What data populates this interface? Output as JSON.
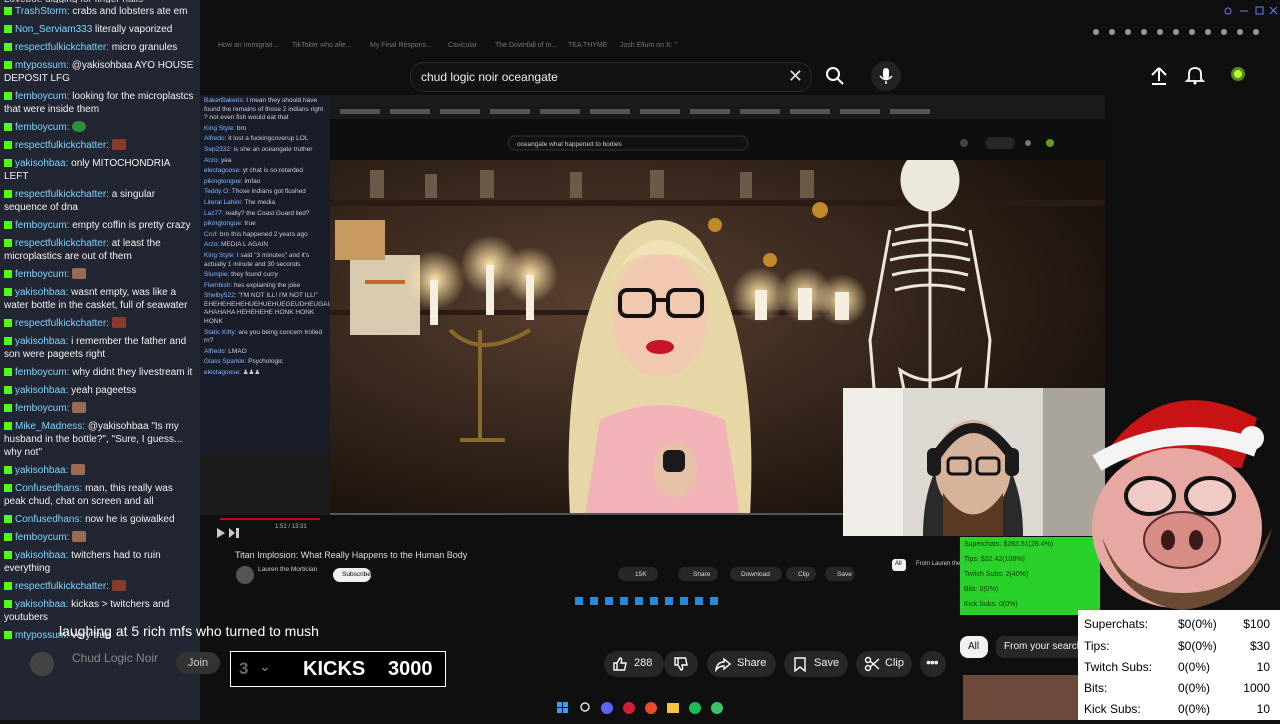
{
  "chat": [
    {
      "user": "TrashStorm:",
      "text": "crabs and lobsters ate em"
    },
    {
      "user": "Non_Serviam333",
      "text": "literally vaporized"
    },
    {
      "user": "respectfulkickchatter:",
      "text": "micro granules"
    },
    {
      "user": "mtypossum:",
      "text": "@yakisohbaa AYO HOUSE DEPOSIT LFG"
    },
    {
      "user": "femboycum:",
      "text": "looking for the microplastcs that were inside them"
    },
    {
      "user": "femboycum:",
      "text": "",
      "emote": "g"
    },
    {
      "user": "respectfulkickchatter:",
      "text": "",
      "emote": "r"
    },
    {
      "user": "yakisohbaa:",
      "text": "only MITOCHONDRIA LEFT"
    },
    {
      "user": "respectfulkickchatter:",
      "text": "a singular sequence of dna"
    },
    {
      "user": "femboycum:",
      "text": "empty coffin is pretty crazy"
    },
    {
      "user": "respectfulkickchatter:",
      "text": "at least the microplastics are out of them"
    },
    {
      "user": "femboycum:",
      "text": "",
      "emote": "e"
    },
    {
      "user": "yakisohbaa:",
      "text": "wasnt empty, was like a water bottle in the casket, full of seawater"
    },
    {
      "user": "respectfulkickchatter:",
      "text": "",
      "emote": "r"
    },
    {
      "user": "yakisohbaa:",
      "text": "i remember the father and son were pageets right"
    },
    {
      "user": "femboycum:",
      "text": "why didnt they livestream it"
    },
    {
      "user": "yakisohbaa:",
      "text": "yeah pageetss"
    },
    {
      "user": "femboycum:",
      "text": "",
      "emote": "e"
    },
    {
      "user": "Mike_Madness:",
      "text": "@yakisohbaa \"Is my husband in the bottle?\", \"Sure, I guess... why not\""
    },
    {
      "user": "yakisohbaa:",
      "text": "",
      "emote": "e"
    },
    {
      "user": "Confusedhans:",
      "text": "man, this really was peak chud, chat on screen and all"
    },
    {
      "user": "Confusedhans:",
      "text": "now he is goiwalked"
    },
    {
      "user": "femboycum:",
      "text": "",
      "emote": "e"
    },
    {
      "user": "yakisohbaa:",
      "text": "twitchers had to ruin everything"
    },
    {
      "user": "respectfulkickchatter:",
      "text": "",
      "emote": "r"
    },
    {
      "user": "yakisohbaa:",
      "text": "kickas > twitchers and youtubers"
    },
    {
      "user": "mtypossum:",
      "text": "very true"
    }
  ],
  "header": {
    "search_query": "chud logic noir oceangate",
    "tabs_ghost": [
      "How an Immigrati...",
      "TikToker who alle...",
      "My Final Respons...",
      "Cavicular",
      "The Downfall of In...",
      "TEA THYME",
      "Josh Ellum on X: \""
    ]
  },
  "inner": {
    "search": "oceangate what happened to bodies",
    "title": "Titan Implosion: What Really Happens to the Human Body",
    "channel": "Lauren the Mortician",
    "subscribe": "Subscribe",
    "time": "1:51 / 13:31",
    "likes": "15K",
    "actions": [
      "Share",
      "Download",
      "Clip",
      "Save"
    ],
    "chat": [
      {
        "u": "BakerBakeris:",
        "t": "I mean they should have found the remains of those 2 indians right ? not even fish would eat that"
      },
      {
        "u": "King Style:",
        "t": "bro"
      },
      {
        "u": "Alfredo:",
        "t": "it lost a fuckingcoverup LOL"
      },
      {
        "u": "Sep2332:",
        "t": "is she an oceangate truther"
      },
      {
        "u": "Arzo:",
        "t": "yea"
      },
      {
        "u": "electagoose:",
        "t": "yt chat is so retarded"
      },
      {
        "u": "pikingtongue:",
        "t": "lmfao"
      },
      {
        "u": "Teddy O:",
        "t": "Those indians got flushed"
      },
      {
        "u": "Literal Lahini:",
        "t": "The media"
      },
      {
        "u": "Laz77:",
        "t": "really? the Coast Guard lied?"
      },
      {
        "u": "pikingtongue:",
        "t": "true"
      },
      {
        "u": "Cruf:",
        "t": "bro this happened 2 years ago"
      },
      {
        "u": "Arzo:",
        "t": "MEDIA L AGAIN"
      },
      {
        "u": "King Style:",
        "t": "I said \"3 minutes\" and it's actually 1 minute and 30 seconds"
      },
      {
        "u": "Slumpie:",
        "t": "they found curry"
      },
      {
        "u": "Flembish:",
        "t": "hes explaining the joke"
      },
      {
        "u": "Shelby522:",
        "t": "\"I'M NOT ILL! I'M NOT ILL!\" EHEHEHEHEHUEHUEHUEGEUDHEUGAUHD AHAHAHA HEHEHEHE HONK HONK HONK"
      },
      {
        "u": "Static Kitty:",
        "t": "are you being concern trolled rn?"
      },
      {
        "u": "Alfredo:",
        "t": "LMAO"
      },
      {
        "u": "Glass Sparkle:",
        "t": "Psychologic"
      },
      {
        "u": "electagoose:",
        "t": "♟♟♟"
      }
    ],
    "filter": [
      "All",
      "From Lauren the..."
    ],
    "overlay": [
      {
        "k": "Superchats:",
        "v": "$283.51(28.4%)"
      },
      {
        "k": "Tips:",
        "v": "$32.42(108%)"
      },
      {
        "k": "Twitch Subs:",
        "v": "2(40%)"
      },
      {
        "k": "Bits:",
        "v": "0(0%)"
      },
      {
        "k": "Kick Subs:",
        "v": "0(0%)"
      }
    ]
  },
  "video": {
    "title": "laughing at 5 rich mfs who turned to mush",
    "channel": "Chud Logic Noir",
    "join": "Join",
    "likes": "288",
    "share": "Share",
    "save": "Save",
    "clip": "Clip",
    "kicks_count": "3",
    "kicks_label": "KICKS",
    "kicks_goal": "3000"
  },
  "filters": {
    "all": "All",
    "from": "From your search"
  },
  "stats": [
    {
      "k": "Superchats:",
      "v": "$0(0%)",
      "g": "$100"
    },
    {
      "k": "Tips:",
      "v": "$0(0%)",
      "g": "$30"
    },
    {
      "k": "Twitch Subs:",
      "v": "0(0%)",
      "g": "10"
    },
    {
      "k": "Bits:",
      "v": "0(0%)",
      "g": "1000"
    },
    {
      "k": "Kick Subs:",
      "v": "0(0%)",
      "g": "10"
    }
  ],
  "colors": {
    "kick_green": "#53fc18",
    "chat_bg": "#262a38",
    "username": "#7fd3ff",
    "dark_bg": "#0f0f0f"
  }
}
